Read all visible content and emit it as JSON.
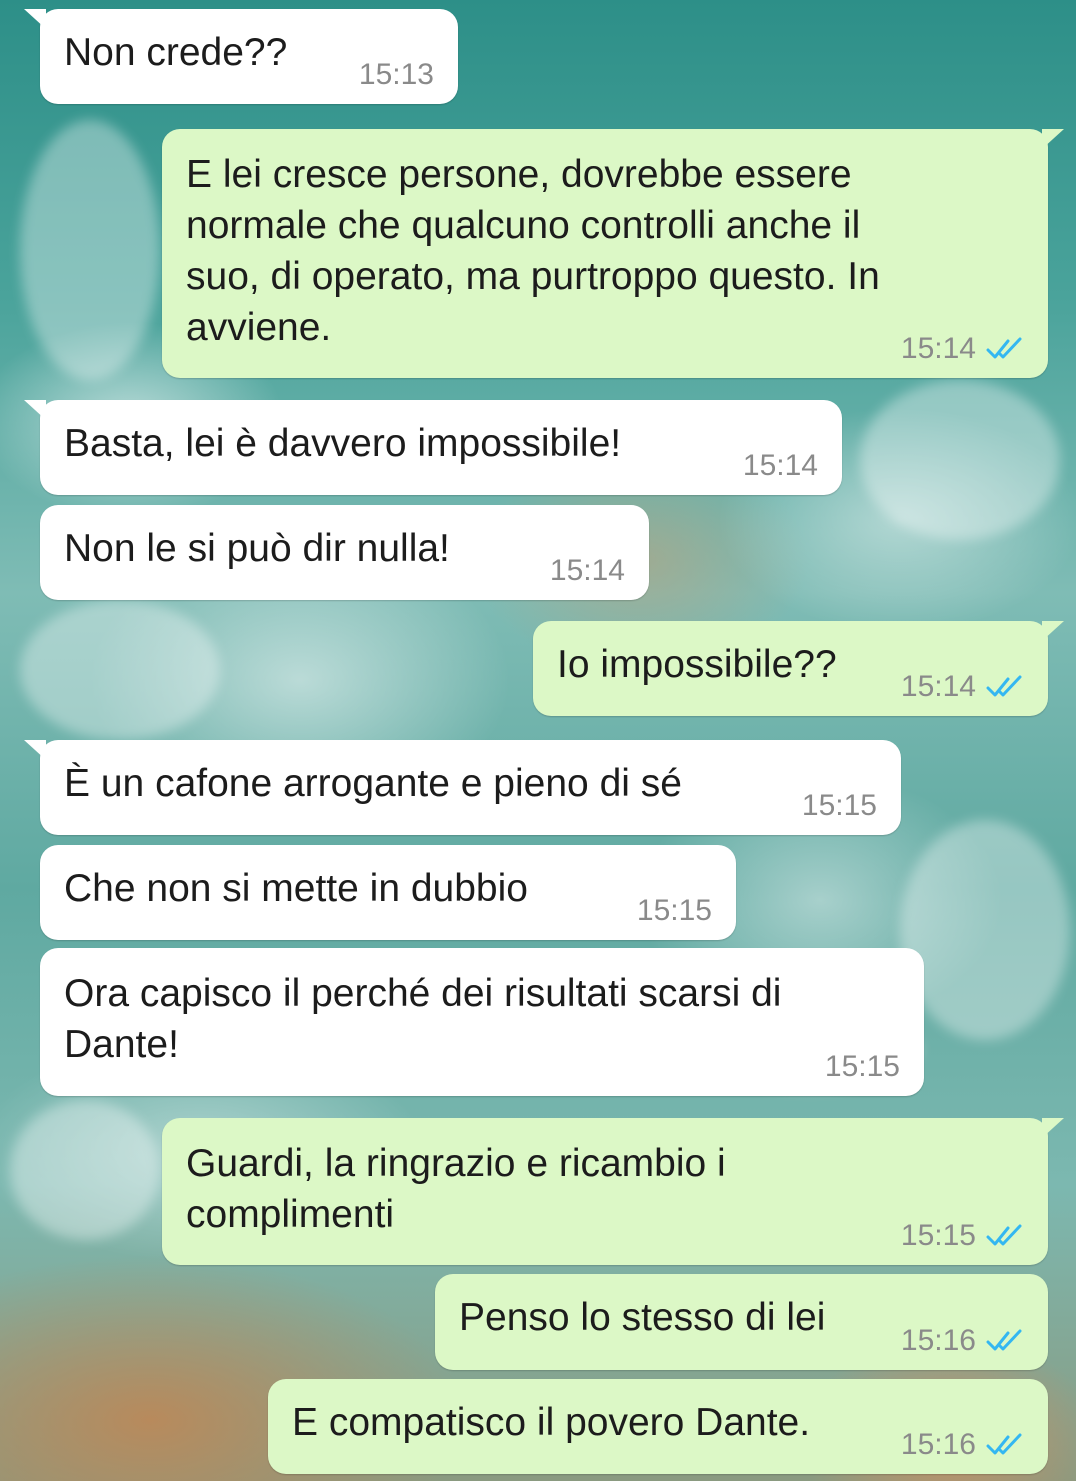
{
  "chat": {
    "messages": [
      {
        "direction": "incoming",
        "lines": [
          "Non crede??"
        ],
        "time": "15:13"
      },
      {
        "direction": "outgoing",
        "lines": [
          "E lei cresce persone, dovrebbe essere",
          "normale che qualcuno controlli anche il",
          "suo, di operato, ma purtroppo questo. In",
          "avviene."
        ],
        "time": "15:14",
        "status": "read"
      },
      {
        "direction": "incoming",
        "lines": [
          "Basta, lei è davvero impossibile!"
        ],
        "time": "15:14"
      },
      {
        "direction": "incoming",
        "lines": [
          "Non le si può dir nulla!"
        ],
        "time": "15:14"
      },
      {
        "direction": "outgoing",
        "lines": [
          "Io impossibile??"
        ],
        "time": "15:14",
        "status": "read"
      },
      {
        "direction": "incoming",
        "lines": [
          "È un cafone arrogante e pieno di sé"
        ],
        "time": "15:15"
      },
      {
        "direction": "incoming",
        "lines": [
          "Che non si mette in dubbio"
        ],
        "time": "15:15"
      },
      {
        "direction": "incoming",
        "lines": [
          "Ora capisco il perché dei risultati scarsi di",
          "Dante!"
        ],
        "time": "15:15"
      },
      {
        "direction": "outgoing",
        "lines": [
          "Guardi, la ringrazio e ricambio i",
          "complimenti"
        ],
        "time": "15:15",
        "status": "read"
      },
      {
        "direction": "outgoing",
        "lines": [
          "Penso lo stesso di lei"
        ],
        "time": "15:16",
        "status": "read"
      },
      {
        "direction": "outgoing",
        "lines": [
          "E compatisco il povero Dante."
        ],
        "time": "15:16",
        "status": "read"
      }
    ]
  },
  "icons": {
    "read_receipt": "double-check-icon"
  },
  "colors": {
    "incoming_bubble": "#ffffff",
    "outgoing_bubble": "#dcf8c6",
    "timestamp": "#8a8a8a",
    "read_ticks": "#34b7f1"
  }
}
